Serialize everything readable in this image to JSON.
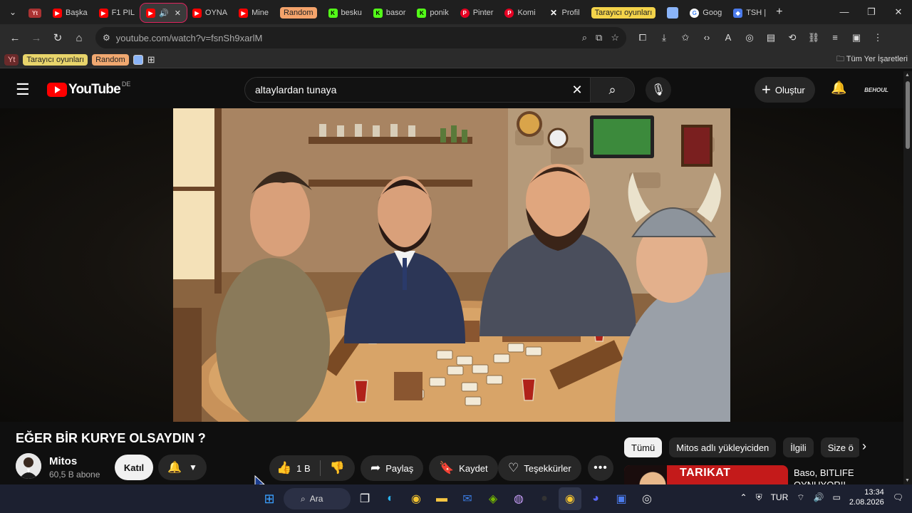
{
  "browser": {
    "tabs": [
      {
        "label": "",
        "icon": "yt-bookmark-icon",
        "type": "yt-pill"
      },
      {
        "label": "Başka",
        "icon": "youtube-icon"
      },
      {
        "label": "F1 PIL",
        "icon": "youtube-icon"
      },
      {
        "label": "",
        "icon": "youtube-icon",
        "active": true
      },
      {
        "label": "OYNA",
        "icon": "youtube-icon"
      },
      {
        "label": "Mine",
        "icon": "youtube-icon"
      },
      {
        "label": "Random",
        "type": "orange-pill"
      },
      {
        "label": "besku",
        "icon": "kick-icon"
      },
      {
        "label": "basor",
        "icon": "kick-icon"
      },
      {
        "label": "ponik",
        "icon": "kick-icon"
      },
      {
        "label": "Pinter",
        "icon": "pinterest-icon"
      },
      {
        "label": "Komi",
        "icon": "pinterest-icon"
      },
      {
        "label": "Profil",
        "icon": "x-icon"
      },
      {
        "label": "Tarayıcı oyunları",
        "type": "yellow-pill"
      },
      {
        "label": "",
        "icon": "blue-square-icon"
      },
      {
        "label": "Goog",
        "icon": "google-icon"
      },
      {
        "label": "TSH |",
        "icon": "blue-app-icon"
      }
    ],
    "url": "youtube.com/watch?v=fsnSh9xarlM",
    "bookmarks": {
      "yt": "Yt",
      "games": "Tarayıcı oyunları",
      "random": "Random",
      "all": "Tüm Yer İşaretleri"
    }
  },
  "youtube": {
    "region": "DE",
    "logo_text": "YouTube",
    "search_query": "altaylardan tunaya",
    "create_label": "Oluştur",
    "account_label": "BEHOUL"
  },
  "video": {
    "title": "EĞER BİR KURYE OLSAYDIN ?",
    "channel": "Mitos",
    "subscribers": "60,5 B abone",
    "join_label": "Katıl",
    "likes": "1 B",
    "share_label": "Paylaş",
    "save_label": "Kaydet",
    "thanks_label": "Teşekkürler"
  },
  "sidebar": {
    "chips": [
      "Tümü",
      "Mitos adlı yükleyiciden",
      "İlgili",
      "Size ö"
    ],
    "rec": {
      "thumb_text": "TARIKAT",
      "title": "Baso, BITLIFE OYNUYOR!!"
    }
  },
  "taskbar": {
    "search_label": "Ara",
    "lang": "TUR",
    "time": "13:34",
    "date": "2.08.2026"
  },
  "colors": {
    "yt_red": "#ff0000",
    "bg": "#0f0f0f",
    "chip_bg": "#272727",
    "active_tab_outline": "#e0245e"
  }
}
